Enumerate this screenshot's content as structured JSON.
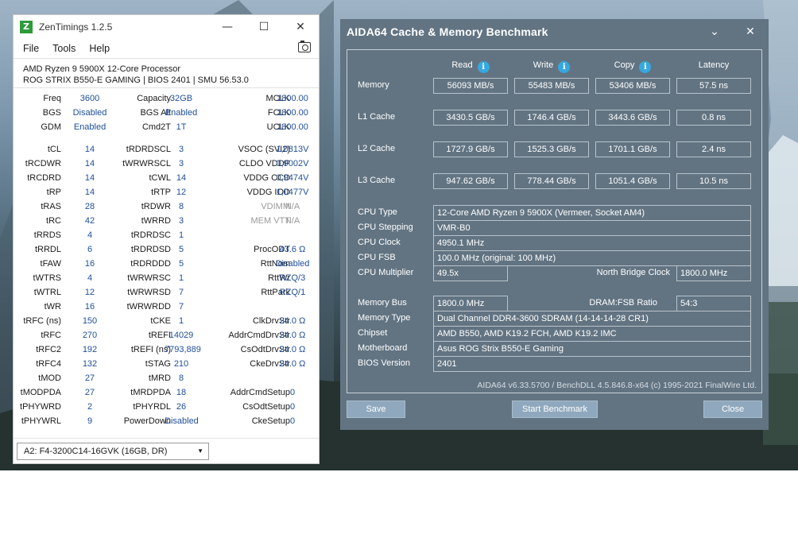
{
  "zen": {
    "title": "ZenTimings 1.2.5",
    "app_icon": "Z",
    "window_buttons": {
      "minimize": "—",
      "maximize": "☐",
      "close": "✕"
    },
    "menu": [
      "File",
      "Tools",
      "Help"
    ],
    "cpu": "AMD Ryzen 9 5900X 12-Core Processor",
    "board": "ROG STRIX B550-E GAMING | BIOS 2401 | SMU 56.53.0",
    "rows": [
      [
        [
          "Freq",
          "3600"
        ],
        [
          "Capacity",
          "32GB"
        ],
        [
          "MCLK",
          "1800.00"
        ]
      ],
      [
        [
          "BGS",
          "Disabled"
        ],
        [
          "BGS Alt",
          "Enabled"
        ],
        [
          "FCLK",
          "1800.00"
        ]
      ],
      [
        [
          "GDM",
          "Enabled"
        ],
        [
          "Cmd2T",
          "1T"
        ],
        [
          "UCLK",
          "1800.00"
        ]
      ],
      [
        [
          "tCL",
          "14"
        ],
        [
          "tRDRDSCL",
          "3"
        ],
        [
          "VSOC (SVI2)",
          "1,0813V"
        ]
      ],
      [
        [
          "tRCDWR",
          "14"
        ],
        [
          "tWRWRSCL",
          "3"
        ],
        [
          "CLDO VDDP",
          "0,9002V"
        ]
      ],
      [
        [
          "tRCDRD",
          "14"
        ],
        [
          "tCWL",
          "14"
        ],
        [
          "VDDG CCD",
          "0,9474V"
        ]
      ],
      [
        [
          "tRP",
          "14"
        ],
        [
          "tRTP",
          "12"
        ],
        [
          "VDDG IOD",
          "1,0477V"
        ]
      ],
      [
        [
          "tRAS",
          "28"
        ],
        [
          "tRDWR",
          "8"
        ],
        [
          "VDIMM",
          "N/A"
        ]
      ],
      [
        [
          "tRC",
          "42"
        ],
        [
          "tWRRD",
          "3"
        ],
        [
          "MEM VTT",
          "N/A"
        ]
      ],
      [
        [
          "tRRDS",
          "4"
        ],
        [
          "tRDRDSC",
          "1"
        ],
        [
          "",
          ""
        ]
      ],
      [
        [
          "tRRDL",
          "6"
        ],
        [
          "tRDRDSD",
          "5"
        ],
        [
          "ProcODT",
          "43.6 Ω"
        ]
      ],
      [
        [
          "tFAW",
          "16"
        ],
        [
          "tRDRDDD",
          "5"
        ],
        [
          "RttNom",
          "Disabled"
        ]
      ],
      [
        [
          "tWTRS",
          "4"
        ],
        [
          "tWRWRSC",
          "1"
        ],
        [
          "RttWr",
          "RZQ/3"
        ]
      ],
      [
        [
          "tWTRL",
          "12"
        ],
        [
          "tWRWRSD",
          "7"
        ],
        [
          "RttPark",
          "RZQ/1"
        ]
      ],
      [
        [
          "tWR",
          "16"
        ],
        [
          "tWRWRDD",
          "7"
        ],
        [
          "",
          ""
        ]
      ],
      [
        [
          "tRFC (ns)",
          "150"
        ],
        [
          "tCKE",
          "1"
        ],
        [
          "ClkDrvStr",
          "24.0 Ω"
        ]
      ],
      [
        [
          "tRFC",
          "270"
        ],
        [
          "tREFI",
          "14029"
        ],
        [
          "AddrCmdDrvStr",
          "24.0 Ω"
        ]
      ],
      [
        [
          "tRFC2",
          "192"
        ],
        [
          "tREFI (ns)",
          "7793,889"
        ],
        [
          "CsOdtDrvStr",
          "24.0 Ω"
        ]
      ],
      [
        [
          "tRFC4",
          "132"
        ],
        [
          "tSTAG",
          "210"
        ],
        [
          "CkeDrvStr",
          "24.0 Ω"
        ]
      ],
      [
        [
          "tMOD",
          "27"
        ],
        [
          "tMRD",
          "8"
        ],
        [
          "",
          ""
        ]
      ],
      [
        [
          "tMODPDA",
          "27"
        ],
        [
          "tMRDPDA",
          "18"
        ],
        [
          "AddrCmdSetup",
          "0"
        ]
      ],
      [
        [
          "tPHYWRD",
          "2"
        ],
        [
          "tPHYRDL",
          "26"
        ],
        [
          "CsOdtSetup",
          "0"
        ]
      ],
      [
        [
          "tPHYWRL",
          "9"
        ],
        [
          "PowerDown",
          "Disabled"
        ],
        [
          "CkeSetup",
          "0"
        ]
      ]
    ],
    "dim_labels": [
      "VDIMM",
      "MEM VTT"
    ],
    "dimm_select": "A2: F4-3200C14-16GVK (16GB, DR)"
  },
  "aida": {
    "title": "AIDA64 Cache & Memory Benchmark",
    "title_buttons": {
      "menu": "⌄",
      "close": "✕"
    },
    "headers": [
      "Read",
      "Write",
      "Copy",
      "Latency"
    ],
    "bench_rows": [
      {
        "label": "Memory",
        "read": "56093 MB/s",
        "write": "55483 MB/s",
        "copy": "53406 MB/s",
        "latency": "57.5 ns"
      },
      {
        "label": "L1 Cache",
        "read": "3430.5 GB/s",
        "write": "1746.4 GB/s",
        "copy": "3443.6 GB/s",
        "latency": "0.8 ns"
      },
      {
        "label": "L2 Cache",
        "read": "1727.9 GB/s",
        "write": "1525.3 GB/s",
        "copy": "1701.1 GB/s",
        "latency": "2.4 ns"
      },
      {
        "label": "L3 Cache",
        "read": "947.62 GB/s",
        "write": "778.44 GB/s",
        "copy": "1051.4 GB/s",
        "latency": "10.5 ns"
      }
    ],
    "cpu_info": {
      "cpu_type_label": "CPU Type",
      "cpu_type": "12-Core AMD Ryzen 9 5900X  (Vermeer, Socket AM4)",
      "cpu_stepping_label": "CPU Stepping",
      "cpu_stepping": "VMR-B0",
      "cpu_clock_label": "CPU Clock",
      "cpu_clock": "4950.1 MHz",
      "cpu_fsb_label": "CPU FSB",
      "cpu_fsb": "100.0 MHz  (original: 100 MHz)",
      "cpu_mult_label": "CPU Multiplier",
      "cpu_mult": "49.5x",
      "nb_clock_label": "North Bridge Clock",
      "nb_clock": "1800.0 MHz"
    },
    "mem_info": {
      "mem_bus_label": "Memory Bus",
      "mem_bus": "1800.0 MHz",
      "dram_fsb_label": "DRAM:FSB Ratio",
      "dram_fsb": "54:3",
      "mem_type_label": "Memory Type",
      "mem_type": "Dual Channel DDR4-3600 SDRAM  (14-14-14-28 CR1)",
      "chipset_label": "Chipset",
      "chipset": "AMD B550, AMD K19.2 FCH, AMD K19.2 IMC",
      "motherboard_label": "Motherboard",
      "motherboard": "Asus ROG Strix B550-E Gaming",
      "bios_label": "BIOS Version",
      "bios": "2401"
    },
    "version": "AIDA64 v6.33.5700 / BenchDLL 4.5.846.8-x64  (c) 1995-2021 FinalWire Ltd.",
    "buttons": {
      "save": "Save",
      "start": "Start Benchmark",
      "close": "Close"
    }
  }
}
